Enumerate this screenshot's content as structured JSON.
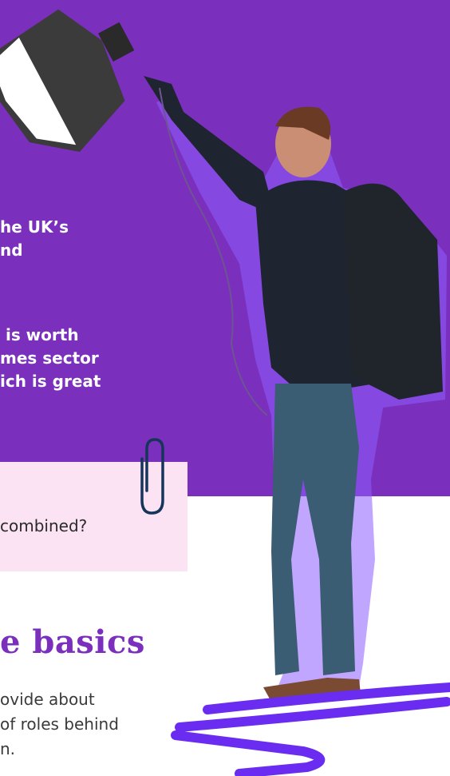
{
  "hero": {
    "lines_a": [
      "he UK’s",
      "nd"
    ],
    "lines_b": [
      " is worth",
      "mes sector",
      "ich is great"
    ]
  },
  "callout": {
    "text": "combined?"
  },
  "section": {
    "title": "e basics",
    "body_lines": [
      "ovide about",
      "of roles behind",
      "n."
    ]
  },
  "colors": {
    "purple": "#7b2fbd",
    "pink": "#fbe3f3",
    "navy": "#17355a"
  },
  "icons": [
    "paperclip-icon",
    "scribble-icon"
  ]
}
